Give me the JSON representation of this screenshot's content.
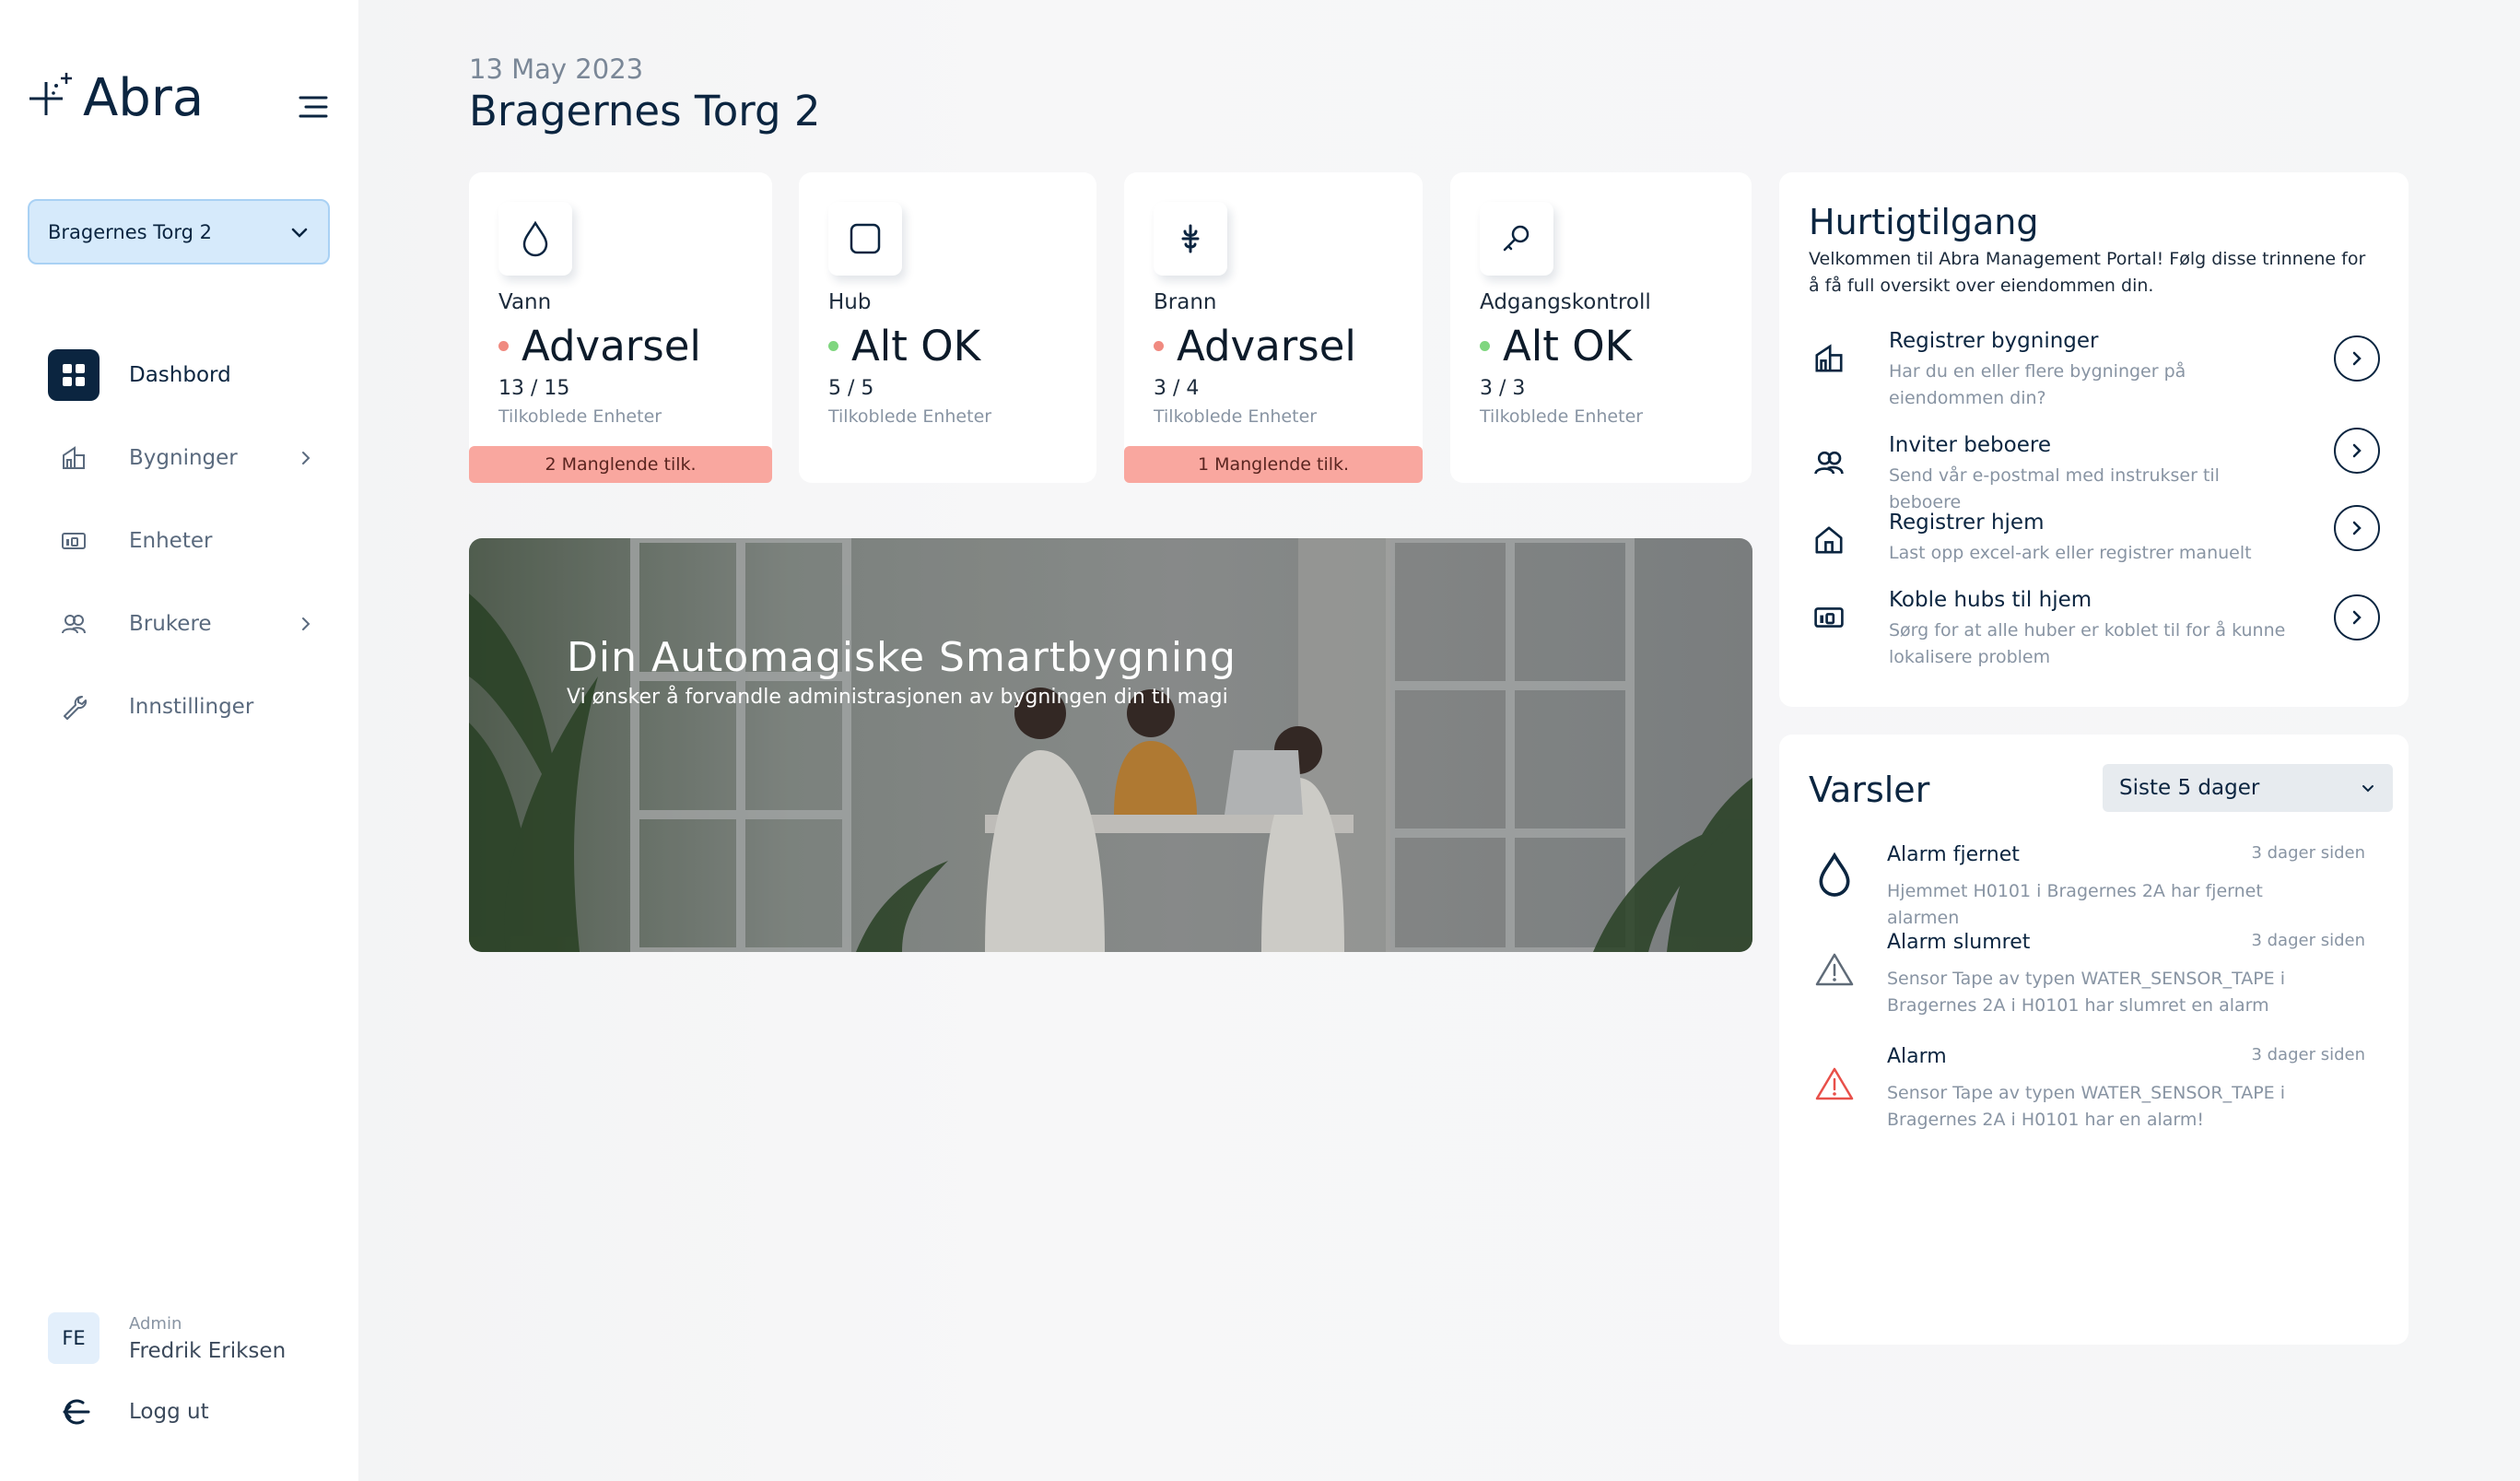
{
  "brand": {
    "name": "Abra"
  },
  "sidebar": {
    "building_select": "Bragernes Torg 2",
    "nav": [
      {
        "label": "Dashbord",
        "icon": "dashboard-icon",
        "active": true
      },
      {
        "label": "Bygninger",
        "icon": "building-icon",
        "has_submenu": true
      },
      {
        "label": "Enheter",
        "icon": "devices-icon"
      },
      {
        "label": "Brukere",
        "icon": "users-icon",
        "has_submenu": true
      },
      {
        "label": "Innstillinger",
        "icon": "wrench-icon"
      }
    ],
    "user": {
      "initials": "FE",
      "role": "Admin",
      "name": "Fredrik Eriksen"
    },
    "logout": "Logg ut"
  },
  "header": {
    "date": "13 May 2023",
    "title": "Bragernes Torg 2"
  },
  "cards": [
    {
      "name": "Vann",
      "icon": "water-drop-icon",
      "status": "Advarsel",
      "status_color": "#f08a80",
      "count": "13 / 15",
      "sub": "Tilkoblede Enheter",
      "missing": "2 Manglende tilk."
    },
    {
      "name": "Hub",
      "icon": "hub-square-icon",
      "status": "Alt OK",
      "status_color": "#7fd67f",
      "count": "5 / 5",
      "sub": "Tilkoblede Enheter",
      "missing": ""
    },
    {
      "name": "Brann",
      "icon": "fire-sprinkler-icon",
      "status": "Advarsel",
      "status_color": "#f08a80",
      "count": "3 / 4",
      "sub": "Tilkoblede Enheter",
      "missing": "1 Manglende tilk."
    },
    {
      "name": "Adgangskontroll",
      "icon": "key-icon",
      "status": "Alt OK",
      "status_color": "#7fd67f",
      "count": "3 / 3",
      "sub": "Tilkoblede Enheter",
      "missing": ""
    }
  ],
  "hero": {
    "title": "Din Automagiske Smartbygning",
    "subtitle": "Vi ønsker å forvandle administrasjonen av bygningen din til magi"
  },
  "quick_access": {
    "title": "Hurtigtilgang",
    "description": "Velkommen til Abra Management Portal! Følg disse trinnene for å få full oversikt over eiendommen din.",
    "items": [
      {
        "title": "Registrer bygninger",
        "desc": "Har du en eller flere bygninger på eiendommen din?",
        "icon": "building-icon"
      },
      {
        "title": "Inviter beboere",
        "desc": "Send vår e-postmal med instrukser til beboere",
        "icon": "users-icon"
      },
      {
        "title": "Registrer hjem",
        "desc": "Last opp excel-ark eller registrer manuelt",
        "icon": "home-icon"
      },
      {
        "title": "Koble hubs til hjem",
        "desc": "Sørg for at alle huber er koblet til for å kunne lokalisere problem",
        "icon": "devices-icon"
      }
    ]
  },
  "alerts": {
    "title": "Varsler",
    "filter": "Siste 5 dager",
    "items": [
      {
        "title": "Alarm fjernet",
        "time": "3 dager siden",
        "desc": "Hjemmet H0101 i Bragernes 2A har fjernet alarmen",
        "icon": "water-drop-icon"
      },
      {
        "title": "Alarm slumret",
        "time": "3 dager siden",
        "desc": "Sensor Tape av typen WATER_SENSOR_TAPE i Bragernes 2A i H0101 har slumret en alarm",
        "icon": "warning-triangle-icon"
      },
      {
        "title": "Alarm",
        "time": "3 dager siden",
        "desc": "Sensor Tape av typen WATER_SENSOR_TAPE i Bragernes 2A i H0101 har en alarm!",
        "icon": "alarm-triangle-icon",
        "color": "#e8504a"
      }
    ]
  }
}
